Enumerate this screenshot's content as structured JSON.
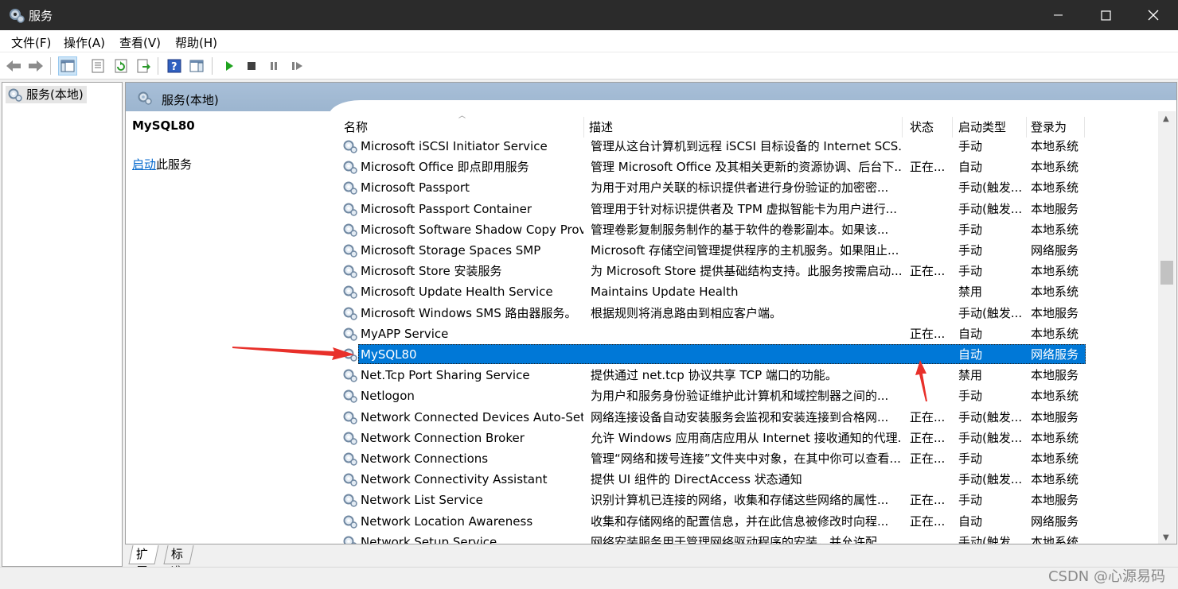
{
  "window": {
    "title": "服务"
  },
  "menu": [
    {
      "label": "文件(F)"
    },
    {
      "label": "操作(A)"
    },
    {
      "label": "查看(V)"
    },
    {
      "label": "帮助(H)"
    }
  ],
  "tree": {
    "root_label": "服务(本地)"
  },
  "main": {
    "header_label": "服务(本地)",
    "selected_service": "MySQL80",
    "start_link": "启动",
    "start_suffix": "此服务"
  },
  "table": {
    "columns": [
      "名称",
      "描述",
      "状态",
      "启动类型",
      "登录为"
    ],
    "rows": [
      {
        "name": "Microsoft iSCSI Initiator Service",
        "desc": "管理从这台计算机到远程 iSCSI 目标设备的 Internet SCS...",
        "status": "",
        "start": "手动",
        "logon": "本地系统"
      },
      {
        "name": "Microsoft Office 即点即用服务",
        "desc": "管理 Microsoft Office 及其相关更新的资源协调、后台下...",
        "status": "正在...",
        "start": "自动",
        "logon": "本地系统"
      },
      {
        "name": "Microsoft Passport",
        "desc": "为用于对用户关联的标识提供者进行身份验证的加密密...",
        "status": "",
        "start": "手动(触发...",
        "logon": "本地系统"
      },
      {
        "name": "Microsoft Passport Container",
        "desc": "管理用于针对标识提供者及 TPM 虚拟智能卡为用户进行...",
        "status": "",
        "start": "手动(触发...",
        "logon": "本地服务"
      },
      {
        "name": "Microsoft Software Shadow Copy Provi...",
        "desc": "管理卷影复制服务制作的基于软件的卷影副本。如果该...",
        "status": "",
        "start": "手动",
        "logon": "本地系统"
      },
      {
        "name": "Microsoft Storage Spaces SMP",
        "desc": "Microsoft 存储空间管理提供程序的主机服务。如果阻止...",
        "status": "",
        "start": "手动",
        "logon": "网络服务"
      },
      {
        "name": "Microsoft Store 安装服务",
        "desc": "为 Microsoft Store 提供基础结构支持。此服务按需启动...",
        "status": "正在...",
        "start": "手动",
        "logon": "本地系统"
      },
      {
        "name": "Microsoft Update Health Service",
        "desc": "Maintains Update Health",
        "status": "",
        "start": "禁用",
        "logon": "本地系统"
      },
      {
        "name": "Microsoft Windows SMS 路由器服务。",
        "desc": "根据规则将消息路由到相应客户端。",
        "status": "",
        "start": "手动(触发...",
        "logon": "本地服务"
      },
      {
        "name": "MyAPP Service",
        "desc": "",
        "status": "正在...",
        "start": "自动",
        "logon": "本地系统"
      },
      {
        "name": "MySQL80",
        "desc": "",
        "status": "",
        "start": "自动",
        "logon": "网络服务"
      },
      {
        "name": "Net.Tcp Port Sharing Service",
        "desc": "提供通过 net.tcp 协议共享 TCP 端口的功能。",
        "status": "",
        "start": "禁用",
        "logon": "本地服务"
      },
      {
        "name": "Netlogon",
        "desc": "为用户和服务身份验证维护此计算机和域控制器之间的...",
        "status": "",
        "start": "手动",
        "logon": "本地系统"
      },
      {
        "name": "Network Connected Devices Auto-Setup",
        "desc": "网络连接设备自动安装服务会监视和安装连接到合格网...",
        "status": "正在...",
        "start": "手动(触发...",
        "logon": "本地服务"
      },
      {
        "name": "Network Connection Broker",
        "desc": "允许 Windows 应用商店应用从 Internet 接收通知的代理...",
        "status": "正在...",
        "start": "手动(触发...",
        "logon": "本地系统"
      },
      {
        "name": "Network Connections",
        "desc": "管理“网络和拨号连接”文件夹中对象，在其中你可以查看...",
        "status": "正在...",
        "start": "手动",
        "logon": "本地系统"
      },
      {
        "name": "Network Connectivity Assistant",
        "desc": "提供 UI 组件的 DirectAccess 状态通知",
        "status": "",
        "start": "手动(触发...",
        "logon": "本地系统"
      },
      {
        "name": "Network List Service",
        "desc": "识别计算机已连接的网络，收集和存储这些网络的属性...",
        "status": "正在...",
        "start": "手动",
        "logon": "本地服务"
      },
      {
        "name": "Network Location Awareness",
        "desc": "收集和存储网络的配置信息，并在此信息被修改时向程...",
        "status": "正在...",
        "start": "自动",
        "logon": "网络服务"
      },
      {
        "name": "Network Setup Service",
        "desc": "网络安装服务用于管理网络驱动程序的安装，并允许配...",
        "status": "",
        "start": "手动(触发...",
        "logon": "本地系统"
      }
    ]
  },
  "tabs": [
    {
      "label": "扩展"
    },
    {
      "label": "标准"
    }
  ],
  "watermark": "CSDN @心源易码",
  "colors": {
    "selection": "#0078d7",
    "titlebar": "#2b2b2b",
    "arrow": "#e8302a"
  }
}
